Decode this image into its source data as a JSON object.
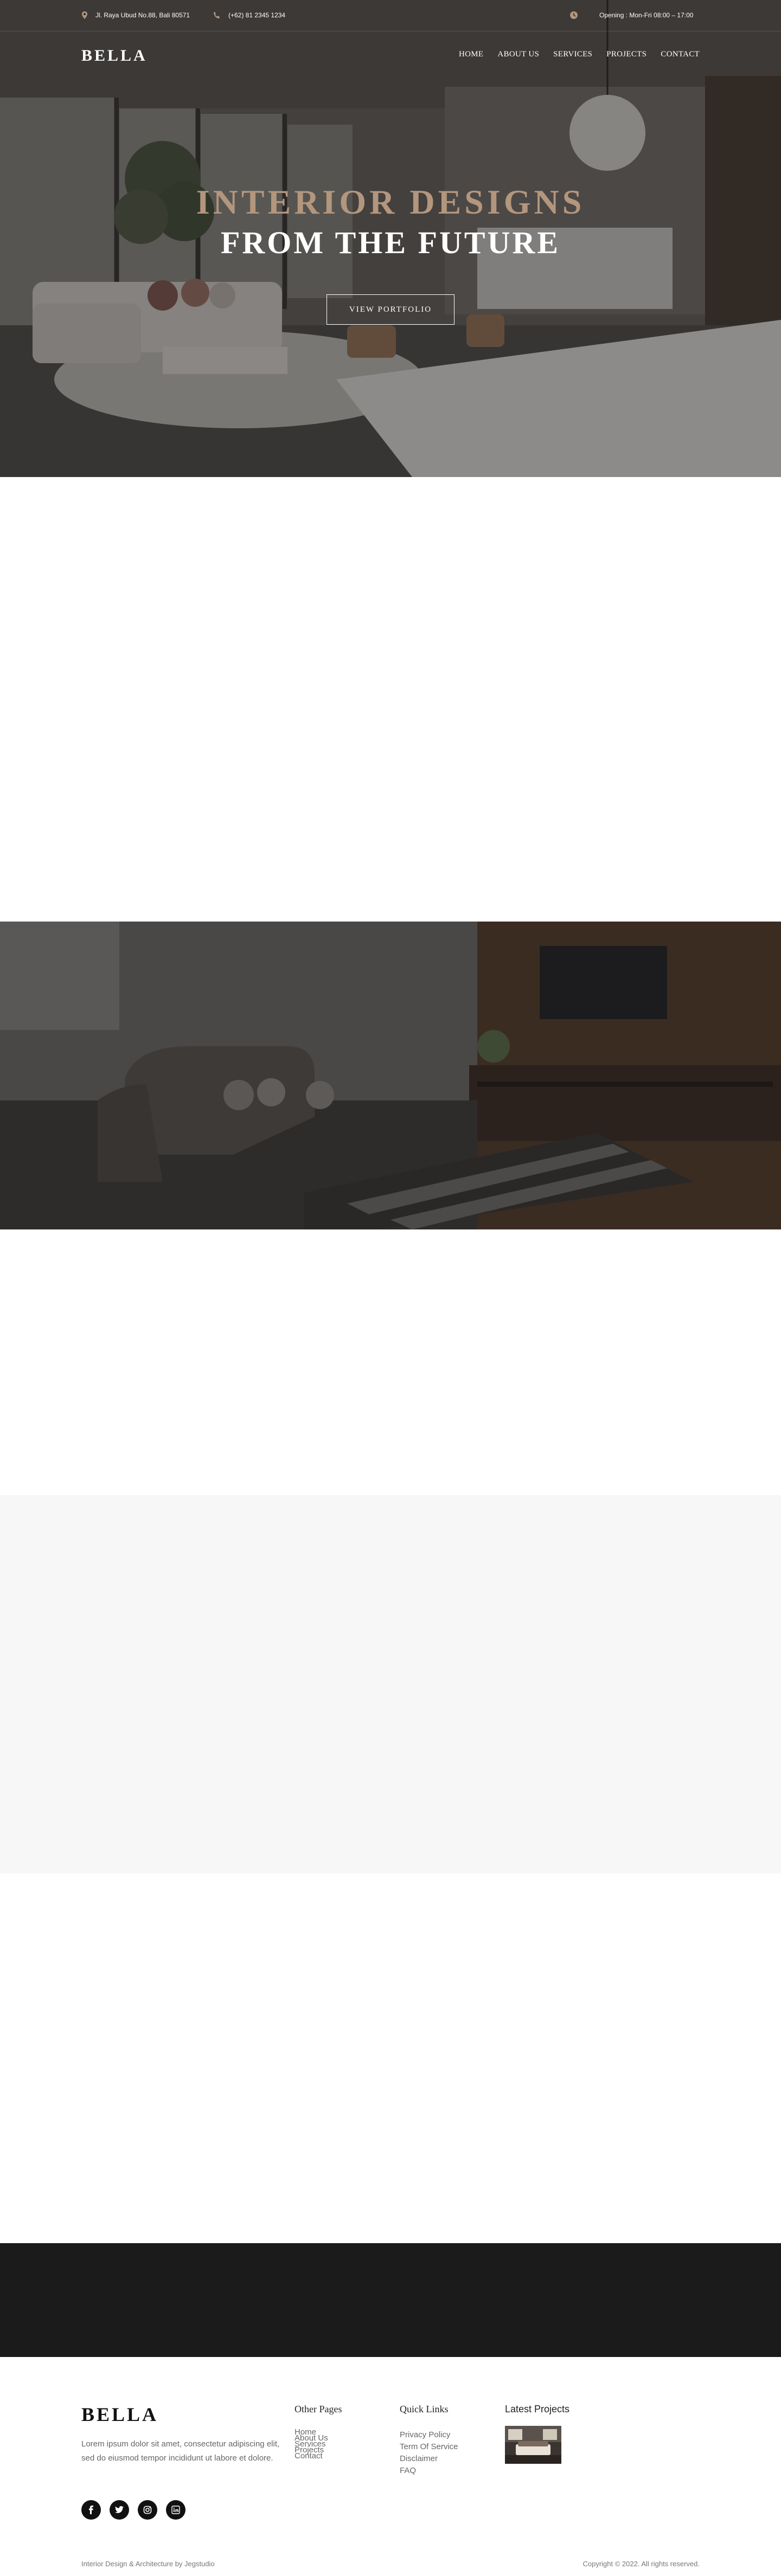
{
  "topbar": {
    "address": "Jl. Raya Ubud No.88, Bali 80571",
    "phone": "(+62) 81 2345 1234",
    "hours": "Opening : Mon-Fri 08:00 – 17:00",
    "icons": [
      "location-pin-icon",
      "phone-icon",
      "clock-icon"
    ]
  },
  "nav": {
    "logo": "BELLA",
    "items": [
      "HOME",
      "ABOUT US",
      "SERVICES",
      "PROJECTS",
      "CONTACT"
    ]
  },
  "hero": {
    "title_line1": "INTERIOR DESIGNS",
    "title_line2": "FROM THE FUTURE",
    "button": "VIEW PORTFOLIO"
  },
  "footer": {
    "logo": "BELLA",
    "about": "Lorem ipsum dolor sit amet, consectetur adipiscing elit, sed do eiusmod tempor incididunt ut labore et dolore.",
    "socials": [
      "facebook-icon",
      "twitter-icon",
      "instagram-icon",
      "linkedin-icon"
    ],
    "other_pages": {
      "title": "Other Pages",
      "links": [
        "Home",
        "About Us",
        "Services",
        "Projects",
        "Contact"
      ]
    },
    "quick_links": {
      "title": "Quick Links",
      "links": [
        "Privacy Policy",
        "Term Of Service",
        "Disclaimer",
        "FAQ"
      ]
    },
    "latest_projects": {
      "title": "Latest Projects"
    },
    "credit": "Interior Design & Architecture by Jegstudio",
    "copyright": "Copyright © 2022. All rights reserved."
  },
  "colors": {
    "accent": "#b2967d",
    "dark_section": "#1b1b1b",
    "grey_section": "#f7f7f7"
  }
}
